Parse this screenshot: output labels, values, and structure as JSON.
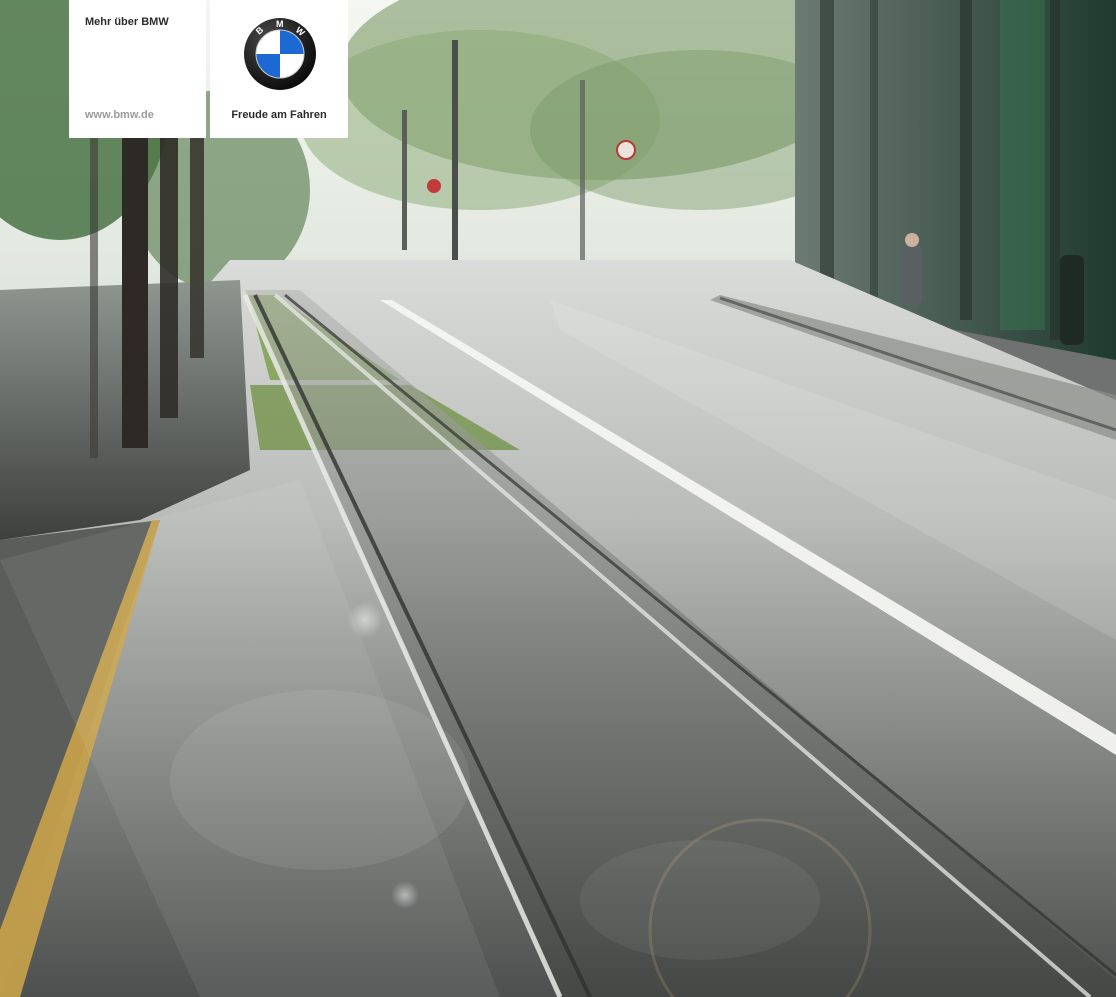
{
  "header": {
    "about_label": "Mehr über BMW",
    "site_link": "www.bmw.de",
    "slogan": "Freude am Fahren",
    "logo_letters": [
      "B",
      "M",
      "W"
    ]
  },
  "logo": {
    "icon": "bmw-roundel-icon",
    "colors": {
      "ring": "#0a0a0a",
      "blue": "#1c69d4",
      "white": "#ffffff"
    }
  },
  "scene": {
    "description_icon": "street-photo",
    "colors": {
      "sky": "#e9efe8",
      "asphalt": "#5f6260",
      "foliage": "#3e6b3a",
      "grass": "#7a9c4a",
      "building": "#2f3d36"
    }
  }
}
